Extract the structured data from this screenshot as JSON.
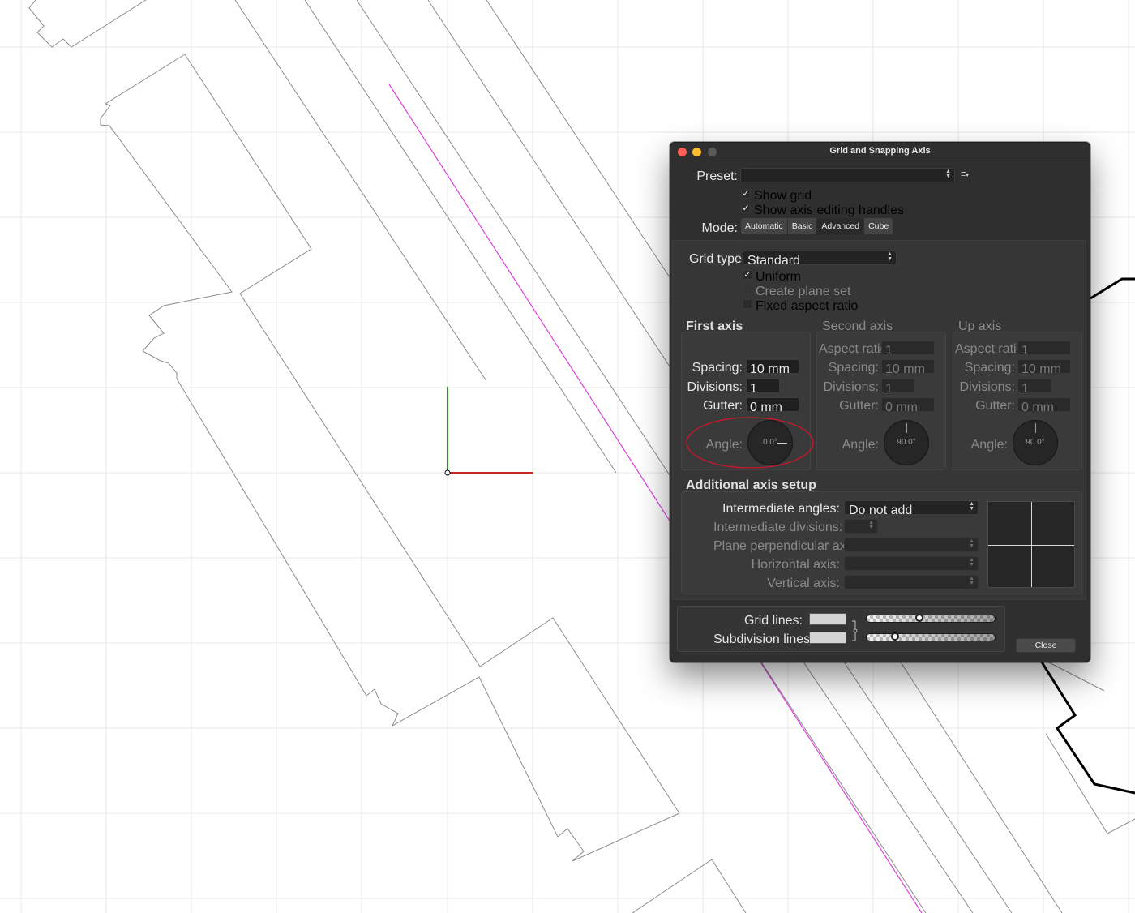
{
  "dialog": {
    "title": "Grid and Snapping Axis",
    "preset_label": "Preset:",
    "preset_value": "",
    "preset_menu_icon": "list-menu-icon",
    "show_grid": {
      "label": "Show grid",
      "checked": true
    },
    "show_axis_handles": {
      "label": "Show axis editing handles",
      "checked": true
    },
    "mode_label": "Mode:",
    "modes": [
      "Automatic",
      "Basic",
      "Advanced",
      "Cube"
    ],
    "active_mode": "Advanced",
    "grid_type_label": "Grid type:",
    "grid_type_value": "Standard",
    "uniform": {
      "label": "Uniform",
      "checked": true
    },
    "create_plane_set": {
      "label": "Create plane set",
      "checked": false,
      "disabled": true
    },
    "fixed_aspect_ratio": {
      "label": "Fixed aspect ratio",
      "checked": false
    },
    "first_axis": {
      "header": "First axis",
      "spacing_label": "Spacing:",
      "spacing": "10 mm",
      "divisions_label": "Divisions:",
      "divisions": "1",
      "gutter_label": "Gutter:",
      "gutter": "0 mm",
      "angle_label": "Angle:",
      "angle": "0.0°"
    },
    "second_axis": {
      "header": "Second axis",
      "aspect_label": "Aspect ratio:",
      "aspect": "1",
      "spacing_label": "Spacing:",
      "spacing": "10 mm",
      "divisions_label": "Divisions:",
      "divisions": "1",
      "gutter_label": "Gutter:",
      "gutter": "0 mm",
      "angle_label": "Angle:",
      "angle": "90.0°"
    },
    "up_axis": {
      "header": "Up axis",
      "aspect_label": "Aspect ratio:",
      "aspect": "1",
      "spacing_label": "Spacing:",
      "spacing": "10 mm",
      "divisions_label": "Divisions:",
      "divisions": "1",
      "gutter_label": "Gutter:",
      "gutter": "0 mm",
      "angle_label": "Angle:",
      "angle": "90.0°"
    },
    "additional": {
      "header": "Additional axis setup",
      "intermediate_angles_label": "Intermediate angles:",
      "intermediate_angles_value": "Do not add",
      "intermediate_divisions_label": "Intermediate divisions:",
      "plane_perpendicular_label": "Plane perpendicular axis:",
      "horizontal_axis_label": "Horizontal axis:",
      "vertical_axis_label": "Vertical axis:"
    },
    "grid_lines_label": "Grid lines:",
    "subdivision_lines_label": "Subdivision lines:",
    "grid_lines_opacity": 0.4,
    "subdivision_lines_opacity": 0.2,
    "close_label": "Close"
  },
  "colors": {
    "magenta_line": "#e040e0",
    "axis_x": "#c62828",
    "axis_y": "#2e8b2e",
    "highlight_ellipse": "#d0162a",
    "dialog_bg": "#2f2f2f"
  }
}
